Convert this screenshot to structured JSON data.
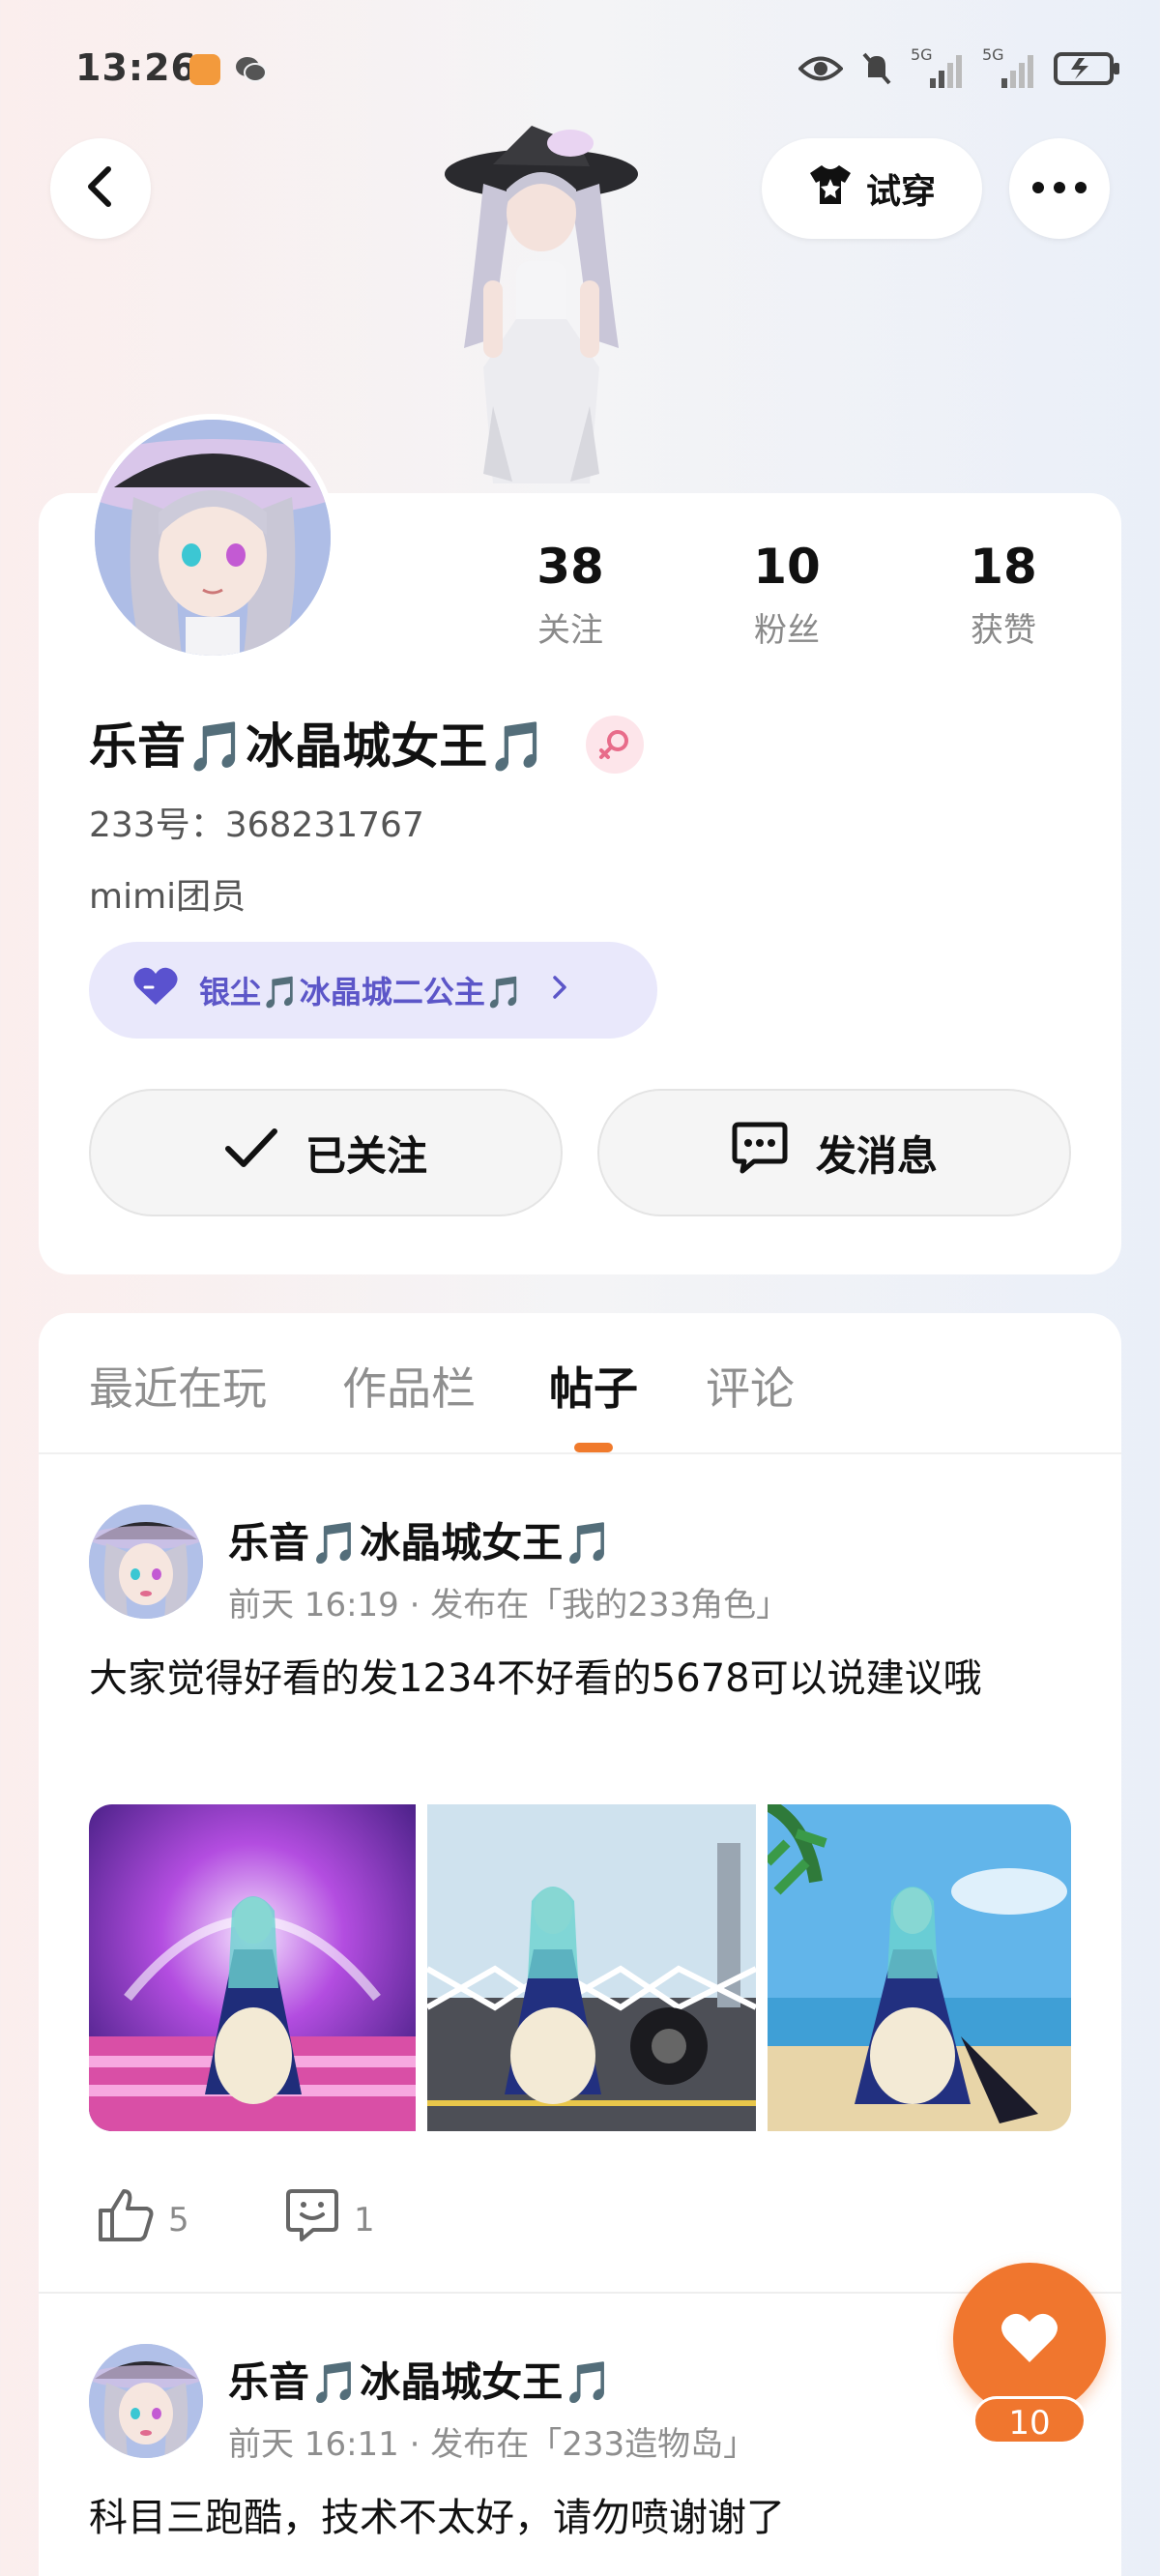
{
  "status_bar": {
    "time": "13:26",
    "signal_1": "5G",
    "signal_2": "5G"
  },
  "header": {
    "back_icon": "chevron-left-icon",
    "tryon_label": "试穿",
    "more_icon": "ellipsis-icon"
  },
  "profile": {
    "stats": [
      {
        "num": "38",
        "label": "关注"
      },
      {
        "num": "10",
        "label": "粉丝"
      },
      {
        "num": "18",
        "label": "获赞"
      }
    ],
    "name": "乐音🎵冰晶城女王🎵",
    "uid": "233号：368231767",
    "team": "mimi团员",
    "cp_label": "银尘🎵冰晶城二公主🎵",
    "follow_label": "已关注",
    "message_label": "发消息"
  },
  "tabs": [
    "最近在玩",
    "作品栏",
    "帖子",
    "评论"
  ],
  "active_tab": 2,
  "posts": [
    {
      "author": "乐音🎵冰晶城女王🎵",
      "meta": "前天 16:19 · 发布在「我的233角色」",
      "text": "大家觉得好看的发1234不好看的5678可以说建议哦",
      "likes": "5",
      "comments": "1"
    },
    {
      "author": "乐音🎵冰晶城女王🎵",
      "meta": "前天 16:11 · 发布在「233造物岛」",
      "text": "科目三跑酷，技术不太好，请勿喷谢谢了"
    }
  ],
  "fab": {
    "count": "10"
  },
  "colors": {
    "accent": "#f0762e",
    "cp_pill_bg": "#e9e8fb",
    "cp_pill_text": "#5c56c8"
  }
}
